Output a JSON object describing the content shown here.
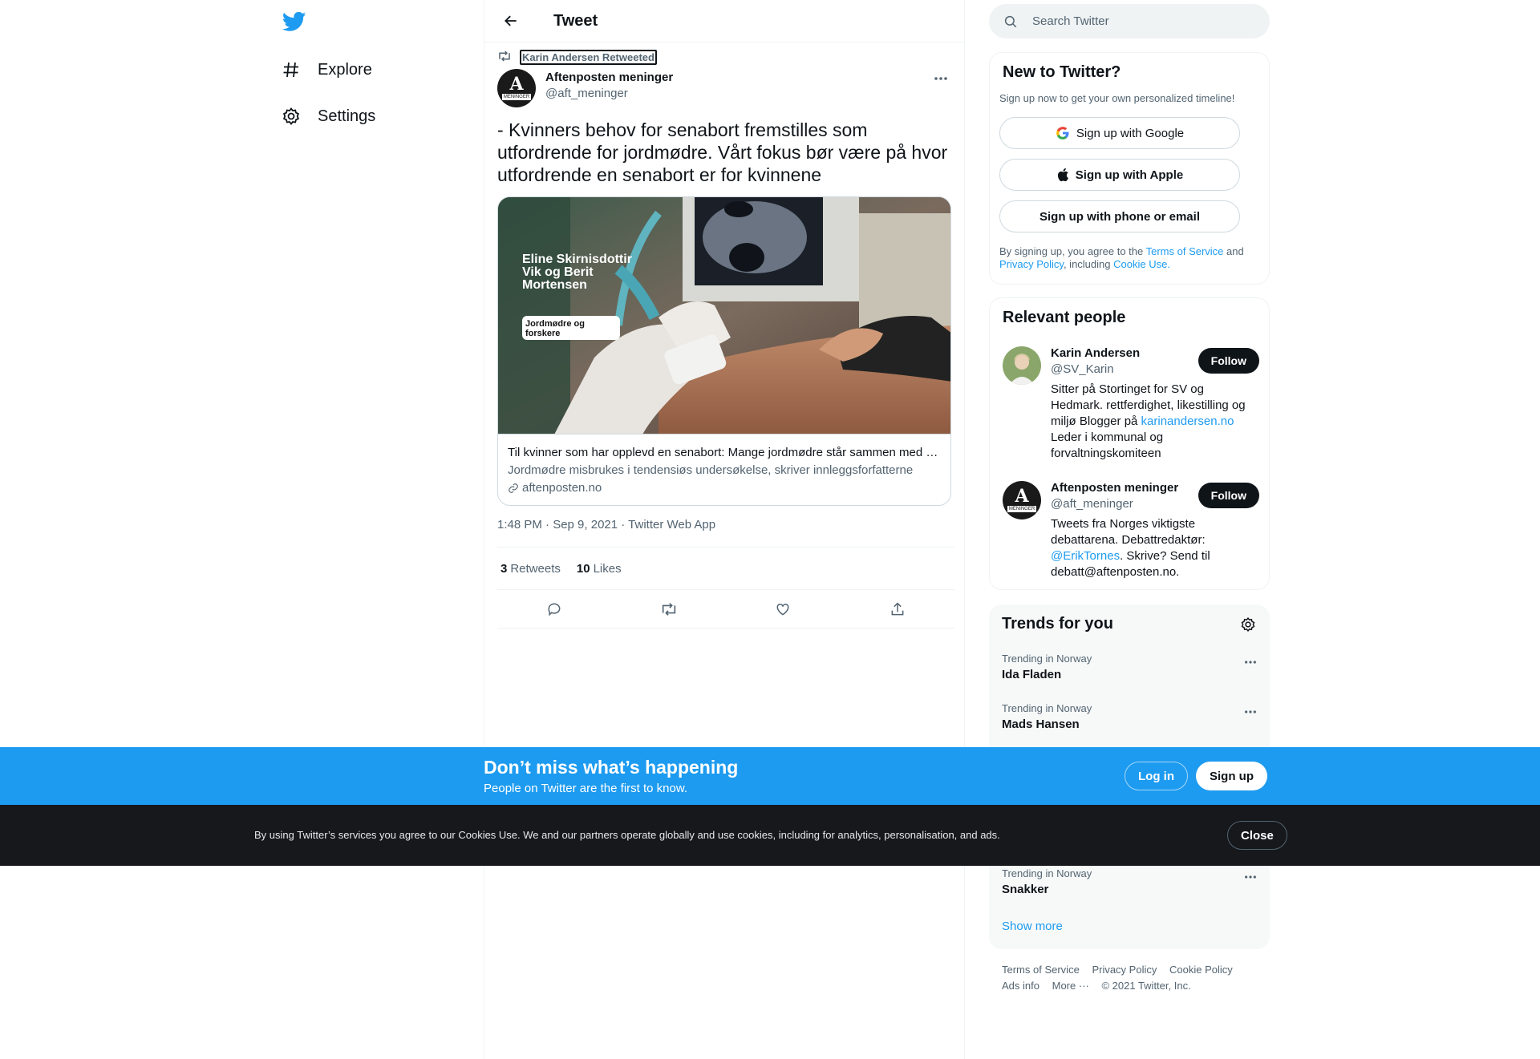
{
  "nav": {
    "items": [
      {
        "label": "Explore",
        "icon": "hashtag-icon"
      },
      {
        "label": "Settings",
        "icon": "gear-icon"
      }
    ]
  },
  "header": {
    "title": "Tweet"
  },
  "tweet": {
    "retweeted_by": "Karin Andersen Retweeted",
    "author_name": "Aftenposten meninger",
    "author_handle": "@aft_meninger",
    "avatar_text": "MENINGER",
    "text": "- Kvinners behov for senabort fremstilles som utfordrende for jordmødre. Vårt fokus bør være på hvor utfordrende en senabort er for kvinnene",
    "card": {
      "image_title": "Eline Skirnisdottir Vik og Berit Mortensen",
      "image_tag": "Jordmødre og forskere",
      "title": "Til kvinner som har opplevd en senabort: Mange jordmødre står sammen med dere",
      "description": "Jordmødre misbrukes i tendensiøs undersøkelse, skriver innleggsforfatterne",
      "domain": "aftenposten.no"
    },
    "timestamp": "1:48 PM · Sep 9, 2021 · Twitter Web App",
    "retweets_count": "3",
    "retweets_label": "Retweets",
    "likes_count": "10",
    "likes_label": "Likes"
  },
  "search": {
    "placeholder": "Search Twitter"
  },
  "new_to_twitter": {
    "title": "New to Twitter?",
    "subtitle": "Sign up now to get your own personalized timeline!",
    "google_label": "Sign up with Google",
    "apple_label": "Sign up with Apple",
    "phone_label": "Sign up with phone or email",
    "legal_prefix": "By signing up, you agree to the ",
    "tos": "Terms of Service",
    "and": " and ",
    "privacy": "Privacy Policy",
    "including": ", including ",
    "cookie_use": "Cookie Use."
  },
  "relevant_people": {
    "title": "Relevant people",
    "follow_label": "Follow",
    "people": [
      {
        "name": "Karin Andersen",
        "handle": "@SV_Karin",
        "bio_before": "Sitter på Stortinget for SV og Hedmark. rettferdighet, likestilling og miljø Blogger på ",
        "bio_link": "karinandersen.no",
        "bio_after": " Leder i kommunal og forvaltningskomiteen"
      },
      {
        "name": "Aftenposten meninger",
        "handle": "@aft_meninger",
        "bio_before": "Tweets fra Norges viktigste debattarena. Debattredaktør: ",
        "bio_link": "@ErikTornes",
        "bio_after": ". Skrive? Send til debatt@aftenposten.no."
      }
    ]
  },
  "trends": {
    "title": "Trends for you",
    "items": [
      {
        "context": "Trending in Norway",
        "name": "Ida Fladen"
      },
      {
        "context": "Trending in Norway",
        "name": "Mads Hansen"
      },
      {
        "context": "Trending in Norway",
        "name": "Snakker"
      }
    ],
    "show_more": "Show more"
  },
  "footer": {
    "links": [
      "Terms of Service",
      "Privacy Policy",
      "Cookie Policy",
      "Ads info",
      "More ···",
      "© 2021 Twitter, Inc."
    ]
  },
  "promo": {
    "title": "Don’t miss what’s happening",
    "subtitle": "People on Twitter are the first to know.",
    "login": "Log in",
    "signup": "Sign up"
  },
  "cookie_bar": {
    "text": "By using Twitter’s services you agree to our Cookies Use. We and our partners operate globally and use cookies, including for analytics, personalisation, and ads.",
    "close": "Close"
  },
  "colors": {
    "brand": "#1d9bf0",
    "text": "#0f1419",
    "muted": "#536471",
    "dark_bar": "#16181c"
  }
}
